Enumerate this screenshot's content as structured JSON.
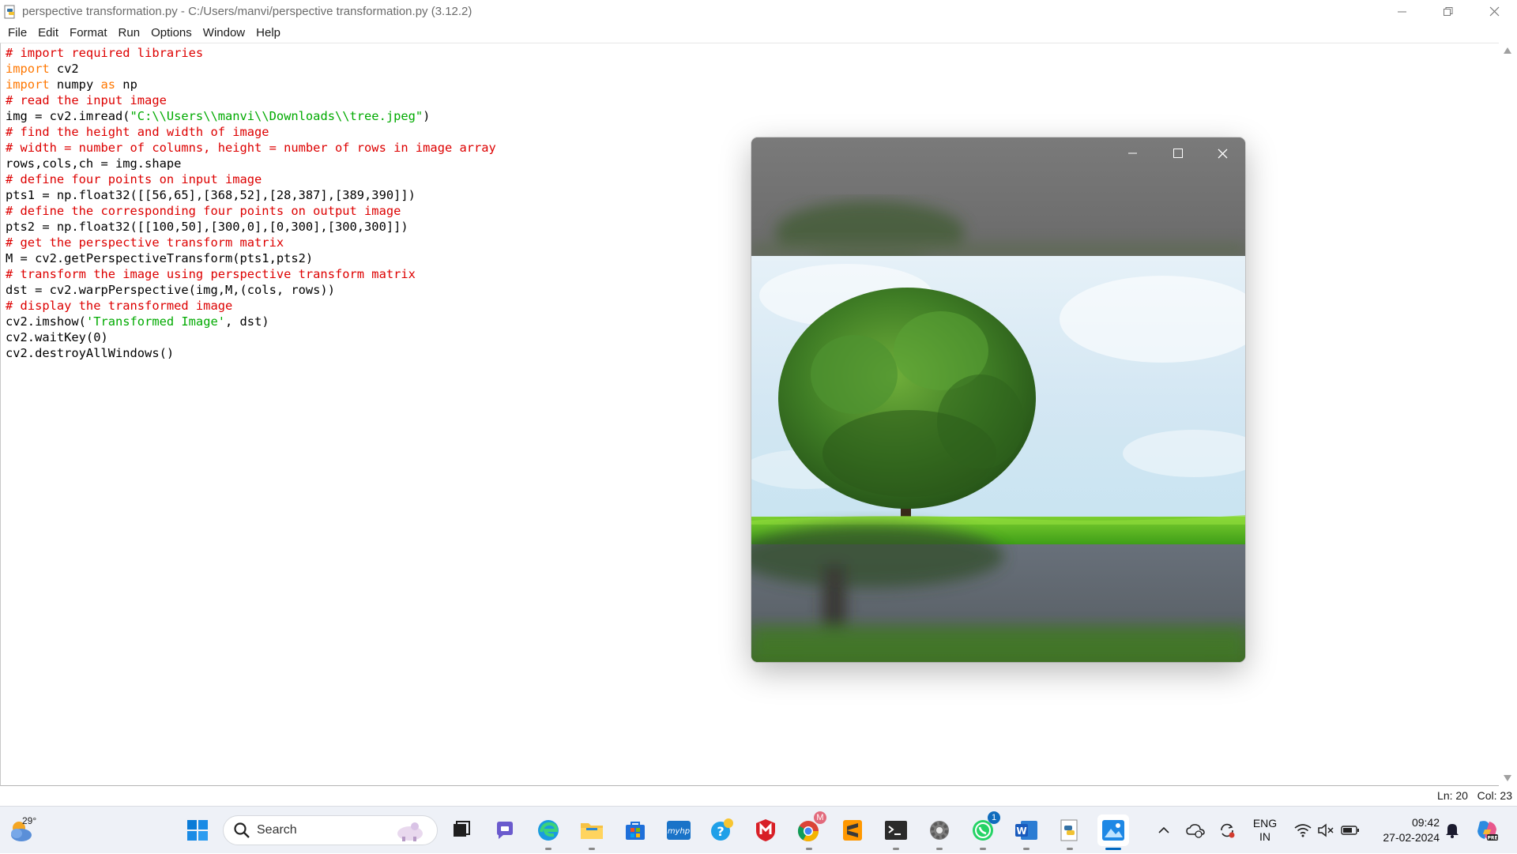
{
  "window": {
    "title": "perspective transformation.py - C:/Users/manvi/perspective transformation.py (3.12.2)"
  },
  "menu": [
    "File",
    "Edit",
    "Format",
    "Run",
    "Options",
    "Window",
    "Help"
  ],
  "code_lines": [
    [
      {
        "t": "# import required libraries",
        "c": "cmt"
      }
    ],
    [
      {
        "t": "import",
        "c": "kw"
      },
      {
        "t": " cv2",
        "c": ""
      }
    ],
    [
      {
        "t": "import",
        "c": "kw"
      },
      {
        "t": " numpy ",
        "c": ""
      },
      {
        "t": "as",
        "c": "kw"
      },
      {
        "t": " np",
        "c": ""
      }
    ],
    [
      {
        "t": "# read the input image",
        "c": "cmt"
      }
    ],
    [
      {
        "t": "img = cv2.imread(",
        "c": ""
      },
      {
        "t": "\"C:\\\\Users\\\\manvi\\\\Downloads\\\\tree.jpeg\"",
        "c": "str"
      },
      {
        "t": ")",
        "c": ""
      }
    ],
    [
      {
        "t": "# find the height and width of image",
        "c": "cmt"
      }
    ],
    [
      {
        "t": "# width = number of columns, height = number of rows in image array",
        "c": "cmt"
      }
    ],
    [
      {
        "t": "rows,cols,ch = img.shape",
        "c": ""
      }
    ],
    [
      {
        "t": "# define four points on input image",
        "c": "cmt"
      }
    ],
    [
      {
        "t": "pts1 = np.float32([[56,65],[368,52],[28,387],[389,390]])",
        "c": ""
      }
    ],
    [
      {
        "t": "# define the corresponding four points on output image",
        "c": "cmt"
      }
    ],
    [
      {
        "t": "pts2 = np.float32([[100,50],[300,0],[0,300],[300,300]])",
        "c": ""
      }
    ],
    [
      {
        "t": "# get the perspective transform matrix",
        "c": "cmt"
      }
    ],
    [
      {
        "t": "M = cv2.getPerspectiveTransform(pts1,pts2)",
        "c": ""
      }
    ],
    [
      {
        "t": "# transform the image using perspective transform matrix",
        "c": "cmt"
      }
    ],
    [
      {
        "t": "dst = cv2.warpPerspective(img,M,(cols, rows))",
        "c": ""
      }
    ],
    [
      {
        "t": "# display the transformed image",
        "c": "cmt"
      }
    ],
    [
      {
        "t": "cv2.imshow(",
        "c": ""
      },
      {
        "t": "'Transformed Image'",
        "c": "str"
      },
      {
        "t": ", dst)",
        "c": ""
      }
    ],
    [
      {
        "t": "cv2.waitKey(0)",
        "c": ""
      }
    ],
    [
      {
        "t": "cv2.destroyAllWindows()",
        "c": ""
      }
    ]
  ],
  "status": {
    "line": "Ln: 20",
    "col": "Col: 23"
  },
  "image_window": {
    "title": ""
  },
  "taskbar": {
    "weather_temp": "29°",
    "search_placeholder": "Search",
    "apps": [
      {
        "name": "start",
        "icon": "windows-logo-icon",
        "open": false
      },
      {
        "name": "task-view",
        "icon": "task-view-icon",
        "open": false
      },
      {
        "name": "teams-chat",
        "icon": "chat-icon",
        "open": false
      },
      {
        "name": "edge",
        "icon": "edge-icon",
        "open": true
      },
      {
        "name": "file-explorer",
        "icon": "folder-icon",
        "open": true
      },
      {
        "name": "store",
        "icon": "store-icon",
        "open": false
      },
      {
        "name": "myhp",
        "icon": "myhp-icon",
        "open": false
      },
      {
        "name": "help",
        "icon": "help-icon",
        "open": false
      },
      {
        "name": "mcafee",
        "icon": "mcafee-icon",
        "open": false
      },
      {
        "name": "chrome",
        "icon": "chrome-icon",
        "open": true,
        "badge": "M"
      },
      {
        "name": "sublime",
        "icon": "sublime-icon",
        "open": false
      },
      {
        "name": "terminal",
        "icon": "terminal-icon",
        "open": true
      },
      {
        "name": "settings",
        "icon": "gear-icon",
        "open": true
      },
      {
        "name": "whatsapp",
        "icon": "whatsapp-icon",
        "open": true,
        "badge": "1"
      },
      {
        "name": "word",
        "icon": "word-icon",
        "open": true
      },
      {
        "name": "python-idle",
        "icon": "python-icon",
        "open": true
      },
      {
        "name": "image-viewer",
        "icon": "image-icon",
        "open": true,
        "active": true
      }
    ],
    "lang_primary": "ENG",
    "lang_secondary": "IN",
    "time": "09:42",
    "date": "27-02-2024"
  }
}
